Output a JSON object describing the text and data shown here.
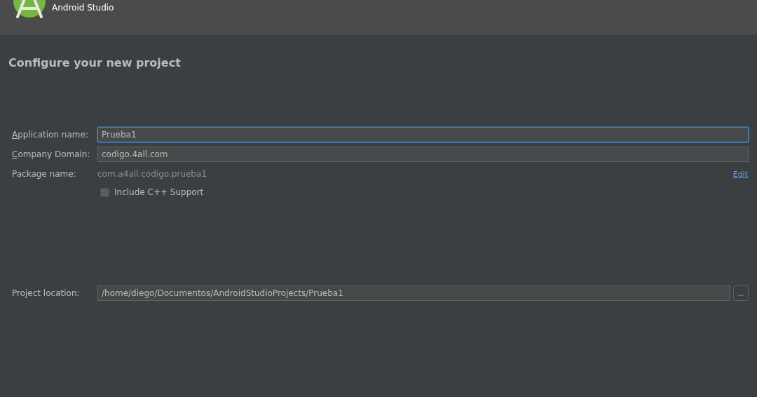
{
  "header": {
    "subtitle": "Android Studio"
  },
  "page_title": "Configure your new project",
  "fields": [
    {
      "kind": "input",
      "label": "Application name:",
      "mnemonic": true,
      "value": "Prueba1",
      "focused": true
    },
    {
      "kind": "input",
      "label": "Company Domain:",
      "mnemonic": true,
      "value": "codigo.4all.com",
      "focused": false
    },
    {
      "kind": "readonly",
      "label": "Package name:",
      "mnemonic": false,
      "value": "com.a4all.codigo.prueba1",
      "link": "Edit"
    }
  ],
  "options": [
    {
      "label": "Include C++ Support",
      "checked": false
    }
  ],
  "location": {
    "label": "Project location:",
    "value": "/home/diego/Documentos/AndroidStudioProjects/Prueba1",
    "browse": "..."
  }
}
